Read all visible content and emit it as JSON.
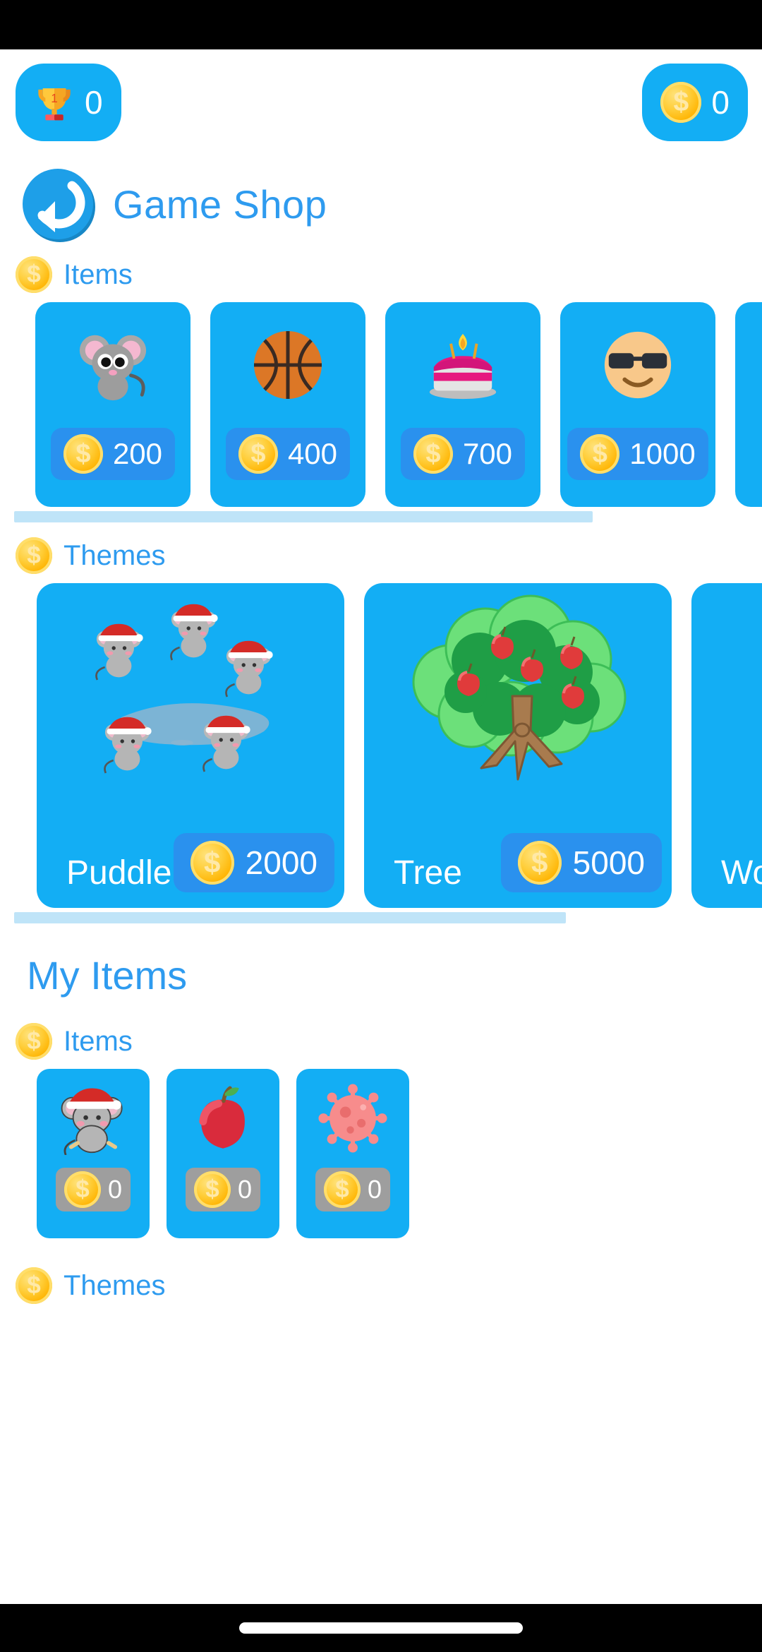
{
  "header": {
    "title": "Game Shop",
    "back_icon": "back-arrow-icon"
  },
  "topbar": {
    "trophy_icon": "trophy-icon",
    "trophy_count": "0",
    "coin_icon": "coin-icon",
    "coin_count": "0"
  },
  "shop": {
    "items_label": "Items",
    "themes_label": "Themes",
    "items": [
      {
        "icon": "mouse-icon",
        "price": "200"
      },
      {
        "icon": "basketball-icon",
        "price": "400"
      },
      {
        "icon": "birthday-cake-icon",
        "price": "700"
      },
      {
        "icon": "sunglasses-face-icon",
        "price": "1000"
      },
      {
        "icon": "hidden-icon",
        "price": ""
      }
    ],
    "themes": [
      {
        "name": "Puddle",
        "price": "2000",
        "art": "mice-puddle-art"
      },
      {
        "name": "Tree",
        "price": "5000",
        "art": "apple-tree-art"
      },
      {
        "name": "Wor",
        "price": "",
        "art": "world-virus-art"
      }
    ]
  },
  "my_items": {
    "title": "My Items",
    "items_label": "Items",
    "themes_label": "Themes",
    "items": [
      {
        "icon": "santa-mouse-icon",
        "count": "0"
      },
      {
        "icon": "apple-icon",
        "count": "0"
      },
      {
        "icon": "virus-icon",
        "count": "0"
      }
    ],
    "themes": []
  },
  "colors": {
    "accent_blue": "#2E9BEF",
    "card_blue": "#13AEF4",
    "price_blue": "#2A91EE",
    "owned_grey": "#9E9E9E",
    "coin_gold": "#FFB300",
    "scrollbar": "#BFE4F8"
  }
}
